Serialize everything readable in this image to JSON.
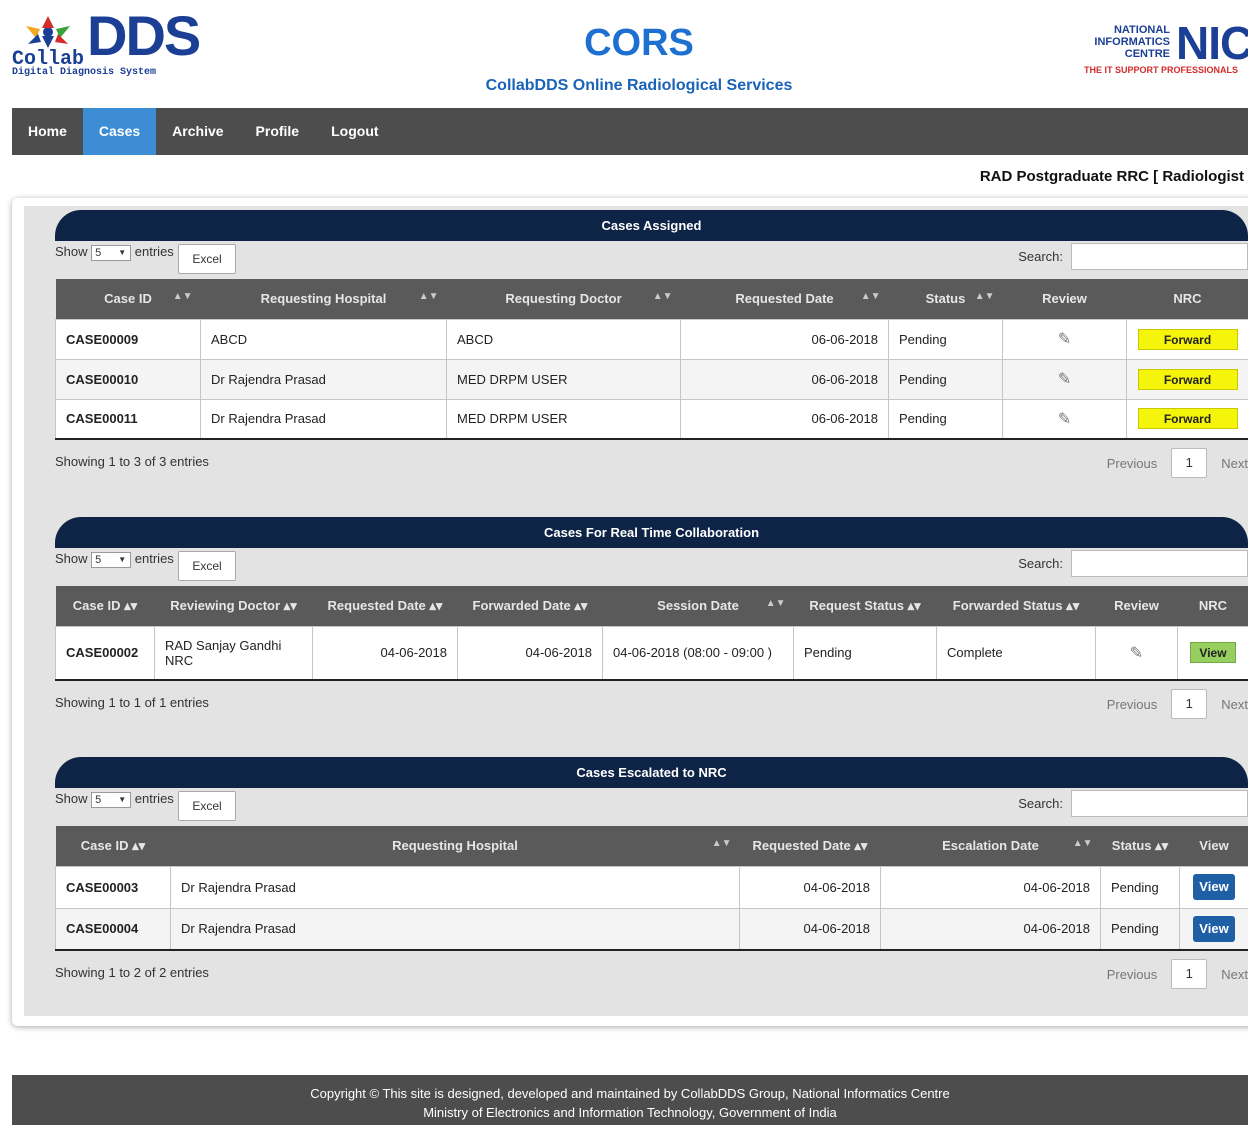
{
  "branding": {
    "logo_word": "DDS",
    "logo_collab": "Collab",
    "logo_tagline": "Digital Diagnosis System",
    "title": "CORS",
    "subtitle": "CollabDDS Online Radiological Services",
    "nic_line1": "NATIONAL",
    "nic_line2": "INFORMATICS",
    "nic_line3": "CENTRE",
    "nic_big": "NIC",
    "nic_tag": "THE IT SUPPORT PROFESSIONALS"
  },
  "nav": {
    "items": [
      {
        "label": "Home"
      },
      {
        "label": "Cases",
        "active": true
      },
      {
        "label": "Archive"
      },
      {
        "label": "Profile"
      },
      {
        "label": "Logout"
      }
    ]
  },
  "user": {
    "line": "RAD Postgraduate RRC [ Radiologist"
  },
  "common": {
    "show_label": "Show",
    "entries_label": "entries",
    "page_size": "5",
    "excel_label": "Excel",
    "search_label": "Search:",
    "previous": "Previous",
    "page": "1",
    "next": "Next"
  },
  "assigned": {
    "title": "Cases Assigned",
    "columns": [
      "Case ID",
      "Requesting Hospital",
      "Requesting Doctor",
      "Requested Date",
      "Status",
      "Review",
      "NRC"
    ],
    "rows": [
      {
        "id": "CASE00009",
        "hospital": "ABCD",
        "doctor": "ABCD",
        "date": "06-06-2018",
        "status": "Pending",
        "action": "Forward"
      },
      {
        "id": "CASE00010",
        "hospital": "Dr Rajendra Prasad",
        "doctor": "MED DRPM USER",
        "date": "06-06-2018",
        "status": "Pending",
        "action": "Forward"
      },
      {
        "id": "CASE00011",
        "hospital": "Dr Rajendra Prasad",
        "doctor": "MED DRPM USER",
        "date": "06-06-2018",
        "status": "Pending",
        "action": "Forward"
      }
    ],
    "info": "Showing 1 to 3 of 3 entries"
  },
  "realtime": {
    "title": "Cases For Real Time Collaboration",
    "columns": [
      "Case ID",
      "Reviewing Doctor",
      "Requested Date",
      "Forwarded Date",
      "Session Date",
      "Request Status",
      "Forwarded Status",
      "Review",
      "NRC"
    ],
    "rows": [
      {
        "id": "CASE00002",
        "doctor": "RAD Sanjay Gandhi NRC",
        "requested": "04-06-2018",
        "forwarded": "04-06-2018",
        "session": "04-06-2018 (08:00 - 09:00 )",
        "request_status": "Pending",
        "forwarded_status": "Complete",
        "action": "View"
      }
    ],
    "info": "Showing 1 to 1 of 1 entries"
  },
  "escalated": {
    "title": "Cases Escalated to NRC",
    "columns": [
      "Case ID",
      "Requesting Hospital",
      "Requested Date",
      "Escalation Date",
      "Status",
      "View"
    ],
    "rows": [
      {
        "id": "CASE00003",
        "hospital": "Dr Rajendra Prasad",
        "requested": "04-06-2018",
        "escalation": "04-06-2018",
        "status": "Pending",
        "action": "View"
      },
      {
        "id": "CASE00004",
        "hospital": "Dr Rajendra Prasad",
        "requested": "04-06-2018",
        "escalation": "04-06-2018",
        "status": "Pending",
        "action": "View"
      }
    ],
    "info": "Showing 1 to 2 of 2 entries"
  },
  "footer": {
    "line1": "Copyright © This site is designed, developed and maintained by CollabDDS Group, National Informatics Centre",
    "line2": "Ministry of Electronics and Information Technology, Government of India"
  }
}
